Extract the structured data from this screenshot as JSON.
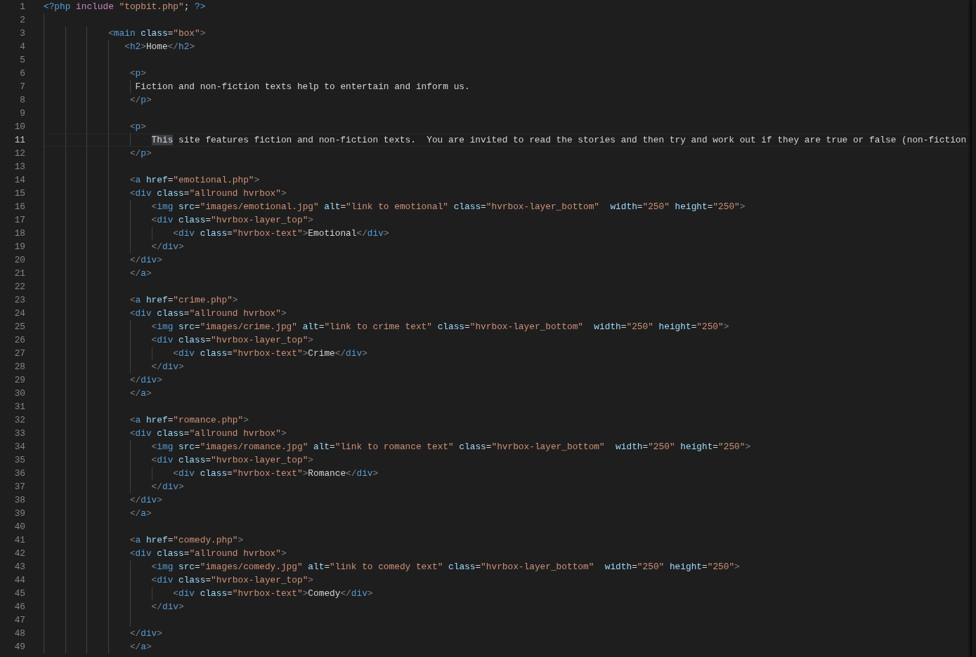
{
  "editor": {
    "lines": [
      {
        "number": "1",
        "current": false,
        "tokens": [
          {
            "kind": "php",
            "text": "<?php"
          },
          {
            "kind": "keyword",
            "text": " include"
          },
          {
            "kind": "string",
            "text": " \"topbit.php\""
          },
          {
            "kind": "text",
            "text": ";"
          },
          {
            "kind": "php",
            "text": " ?>"
          }
        ]
      },
      {
        "number": "2",
        "current": false
      },
      {
        "number": "3",
        "current": false,
        "tokens": [
          {
            "kind": "punct",
            "text": "            <"
          },
          {
            "kind": "tag",
            "text": "main"
          },
          {
            "kind": "attr",
            "text": " class"
          },
          {
            "kind": "text",
            "text": "="
          },
          {
            "kind": "string",
            "text": "\"box\""
          },
          {
            "kind": "punct",
            "text": ">"
          }
        ]
      },
      {
        "number": "4",
        "current": false,
        "tokens": [
          {
            "kind": "punct",
            "text": "               <"
          },
          {
            "kind": "tag",
            "text": "h2"
          },
          {
            "kind": "punct",
            "text": ">"
          },
          {
            "kind": "text",
            "text": "Home"
          },
          {
            "kind": "punct",
            "text": "</"
          },
          {
            "kind": "tag",
            "text": "h2"
          },
          {
            "kind": "punct",
            "text": ">"
          }
        ]
      },
      {
        "number": "5",
        "current": false
      },
      {
        "number": "6",
        "current": false,
        "tokens": [
          {
            "kind": "punct",
            "text": "                <"
          },
          {
            "kind": "tag",
            "text": "p"
          },
          {
            "kind": "punct",
            "text": ">"
          }
        ]
      },
      {
        "number": "7",
        "current": false,
        "tokens": [
          {
            "kind": "text",
            "text": "                 Fiction and non-fiction texts help to entertain and inform us."
          }
        ]
      },
      {
        "number": "8",
        "current": false,
        "tokens": [
          {
            "kind": "punct",
            "text": "                </"
          },
          {
            "kind": "tag",
            "text": "p"
          },
          {
            "kind": "punct",
            "text": ">"
          }
        ]
      },
      {
        "number": "9",
        "current": false
      },
      {
        "number": "10",
        "current": false,
        "tokens": [
          {
            "kind": "punct",
            "text": "                <"
          },
          {
            "kind": "tag",
            "text": "p"
          },
          {
            "kind": "punct",
            "text": ">"
          }
        ]
      },
      {
        "number": "11",
        "current": true,
        "tokens": [
          {
            "kind": "highlight",
            "text": "                    This"
          },
          {
            "kind": "text",
            "text": " site features fiction and non-fiction texts.  You are invited to read the stories and then try and work out if they are true or false (non-fiction"
          }
        ]
      },
      {
        "number": "12",
        "current": false,
        "tokens": [
          {
            "kind": "punct",
            "text": "                </"
          },
          {
            "kind": "tag",
            "text": "p"
          },
          {
            "kind": "punct",
            "text": ">"
          }
        ]
      },
      {
        "number": "13",
        "current": false
      },
      {
        "number": "14",
        "current": false,
        "tokens": [
          {
            "kind": "punct",
            "text": "                <"
          },
          {
            "kind": "tag",
            "text": "a"
          },
          {
            "kind": "attr",
            "text": " href"
          },
          {
            "kind": "text",
            "text": "="
          },
          {
            "kind": "string",
            "text": "\"emotional.php\""
          },
          {
            "kind": "punct",
            "text": ">"
          }
        ]
      },
      {
        "number": "15",
        "current": false,
        "tokens": [
          {
            "kind": "punct",
            "text": "                <"
          },
          {
            "kind": "tag",
            "text": "div"
          },
          {
            "kind": "attr",
            "text": " class"
          },
          {
            "kind": "text",
            "text": "="
          },
          {
            "kind": "string",
            "text": "\"allround hvrbox\""
          },
          {
            "kind": "punct",
            "text": ">"
          }
        ]
      },
      {
        "number": "16",
        "current": false,
        "tokens": [
          {
            "kind": "punct",
            "text": "                    <"
          },
          {
            "kind": "tag",
            "text": "img"
          },
          {
            "kind": "attr",
            "text": " src"
          },
          {
            "kind": "text",
            "text": "="
          },
          {
            "kind": "string",
            "text": "\"images/emotional.jpg\""
          },
          {
            "kind": "attr",
            "text": " alt"
          },
          {
            "kind": "text",
            "text": "="
          },
          {
            "kind": "string",
            "text": "\"link to emotional\""
          },
          {
            "kind": "attr",
            "text": " class"
          },
          {
            "kind": "text",
            "text": "="
          },
          {
            "kind": "string",
            "text": "\"hvrbox-layer_bottom\""
          },
          {
            "kind": "attr",
            "text": "  width"
          },
          {
            "kind": "text",
            "text": "="
          },
          {
            "kind": "string",
            "text": "\"250\""
          },
          {
            "kind": "attr",
            "text": " height"
          },
          {
            "kind": "text",
            "text": "="
          },
          {
            "kind": "string",
            "text": "\"250\""
          },
          {
            "kind": "punct",
            "text": ">"
          }
        ]
      },
      {
        "number": "17",
        "current": false,
        "tokens": [
          {
            "kind": "punct",
            "text": "                    <"
          },
          {
            "kind": "tag",
            "text": "div"
          },
          {
            "kind": "attr",
            "text": " class"
          },
          {
            "kind": "text",
            "text": "="
          },
          {
            "kind": "string",
            "text": "\"hvrbox-layer_top\""
          },
          {
            "kind": "punct",
            "text": ">"
          }
        ]
      },
      {
        "number": "18",
        "current": false,
        "tokens": [
          {
            "kind": "punct",
            "text": "                        <"
          },
          {
            "kind": "tag",
            "text": "div"
          },
          {
            "kind": "attr",
            "text": " class"
          },
          {
            "kind": "text",
            "text": "="
          },
          {
            "kind": "string",
            "text": "\"hvrbox-text\""
          },
          {
            "kind": "punct",
            "text": ">"
          },
          {
            "kind": "text",
            "text": "Emotional"
          },
          {
            "kind": "punct",
            "text": "</"
          },
          {
            "kind": "tag",
            "text": "div"
          },
          {
            "kind": "punct",
            "text": ">"
          }
        ]
      },
      {
        "number": "19",
        "current": false,
        "tokens": [
          {
            "kind": "punct",
            "text": "                    </"
          },
          {
            "kind": "tag",
            "text": "div"
          },
          {
            "kind": "punct",
            "text": ">"
          }
        ]
      },
      {
        "number": "20",
        "current": false,
        "tokens": [
          {
            "kind": "punct",
            "text": "                </"
          },
          {
            "kind": "tag",
            "text": "div"
          },
          {
            "kind": "punct",
            "text": ">"
          }
        ]
      },
      {
        "number": "21",
        "current": false,
        "tokens": [
          {
            "kind": "punct",
            "text": "                </"
          },
          {
            "kind": "tag",
            "text": "a"
          },
          {
            "kind": "punct",
            "text": ">"
          }
        ]
      },
      {
        "number": "22",
        "current": false
      },
      {
        "number": "23",
        "current": false,
        "tokens": [
          {
            "kind": "punct",
            "text": "                <"
          },
          {
            "kind": "tag",
            "text": "a"
          },
          {
            "kind": "attr",
            "text": " href"
          },
          {
            "kind": "text",
            "text": "="
          },
          {
            "kind": "string",
            "text": "\"crime.php\""
          },
          {
            "kind": "punct",
            "text": ">"
          }
        ]
      },
      {
        "number": "24",
        "current": false,
        "tokens": [
          {
            "kind": "punct",
            "text": "                <"
          },
          {
            "kind": "tag",
            "text": "div"
          },
          {
            "kind": "attr",
            "text": " class"
          },
          {
            "kind": "text",
            "text": "="
          },
          {
            "kind": "string",
            "text": "\"allround hvrbox\""
          },
          {
            "kind": "punct",
            "text": ">"
          }
        ]
      },
      {
        "number": "25",
        "current": false,
        "tokens": [
          {
            "kind": "punct",
            "text": "                    <"
          },
          {
            "kind": "tag",
            "text": "img"
          },
          {
            "kind": "attr",
            "text": " src"
          },
          {
            "kind": "text",
            "text": "="
          },
          {
            "kind": "string",
            "text": "\"images/crime.jpg\""
          },
          {
            "kind": "attr",
            "text": " alt"
          },
          {
            "kind": "text",
            "text": "="
          },
          {
            "kind": "string",
            "text": "\"link to crime text\""
          },
          {
            "kind": "attr",
            "text": " class"
          },
          {
            "kind": "text",
            "text": "="
          },
          {
            "kind": "string",
            "text": "\"hvrbox-layer_bottom\""
          },
          {
            "kind": "attr",
            "text": "  width"
          },
          {
            "kind": "text",
            "text": "="
          },
          {
            "kind": "string",
            "text": "\"250\""
          },
          {
            "kind": "attr",
            "text": " height"
          },
          {
            "kind": "text",
            "text": "="
          },
          {
            "kind": "string",
            "text": "\"250\""
          },
          {
            "kind": "punct",
            "text": ">"
          }
        ]
      },
      {
        "number": "26",
        "current": false,
        "tokens": [
          {
            "kind": "punct",
            "text": "                    <"
          },
          {
            "kind": "tag",
            "text": "div"
          },
          {
            "kind": "attr",
            "text": " class"
          },
          {
            "kind": "text",
            "text": "="
          },
          {
            "kind": "string",
            "text": "\"hvrbox-layer_top\""
          },
          {
            "kind": "punct",
            "text": ">"
          }
        ]
      },
      {
        "number": "27",
        "current": false,
        "tokens": [
          {
            "kind": "punct",
            "text": "                        <"
          },
          {
            "kind": "tag",
            "text": "div"
          },
          {
            "kind": "attr",
            "text": " class"
          },
          {
            "kind": "text",
            "text": "="
          },
          {
            "kind": "string",
            "text": "\"hvrbox-text\""
          },
          {
            "kind": "punct",
            "text": ">"
          },
          {
            "kind": "text",
            "text": "Crime"
          },
          {
            "kind": "punct",
            "text": "</"
          },
          {
            "kind": "tag",
            "text": "div"
          },
          {
            "kind": "punct",
            "text": ">"
          }
        ]
      },
      {
        "number": "28",
        "current": false,
        "tokens": [
          {
            "kind": "punct",
            "text": "                    </"
          },
          {
            "kind": "tag",
            "text": "div"
          },
          {
            "kind": "punct",
            "text": ">"
          }
        ]
      },
      {
        "number": "29",
        "current": false,
        "tokens": [
          {
            "kind": "punct",
            "text": "                </"
          },
          {
            "kind": "tag",
            "text": "div"
          },
          {
            "kind": "punct",
            "text": ">"
          }
        ]
      },
      {
        "number": "30",
        "current": false,
        "tokens": [
          {
            "kind": "punct",
            "text": "                </"
          },
          {
            "kind": "tag",
            "text": "a"
          },
          {
            "kind": "punct",
            "text": ">"
          }
        ]
      },
      {
        "number": "31",
        "current": false
      },
      {
        "number": "32",
        "current": false,
        "tokens": [
          {
            "kind": "punct",
            "text": "                <"
          },
          {
            "kind": "tag",
            "text": "a"
          },
          {
            "kind": "attr",
            "text": " href"
          },
          {
            "kind": "text",
            "text": "="
          },
          {
            "kind": "string",
            "text": "\"romance.php\""
          },
          {
            "kind": "punct",
            "text": ">"
          }
        ]
      },
      {
        "number": "33",
        "current": false,
        "tokens": [
          {
            "kind": "punct",
            "text": "                <"
          },
          {
            "kind": "tag",
            "text": "div"
          },
          {
            "kind": "attr",
            "text": " class"
          },
          {
            "kind": "text",
            "text": "="
          },
          {
            "kind": "string",
            "text": "\"allround hvrbox\""
          },
          {
            "kind": "punct",
            "text": ">"
          }
        ]
      },
      {
        "number": "34",
        "current": false,
        "tokens": [
          {
            "kind": "punct",
            "text": "                    <"
          },
          {
            "kind": "tag",
            "text": "img"
          },
          {
            "kind": "attr",
            "text": " src"
          },
          {
            "kind": "text",
            "text": "="
          },
          {
            "kind": "string",
            "text": "\"images/romance.jpg\""
          },
          {
            "kind": "attr",
            "text": " alt"
          },
          {
            "kind": "text",
            "text": "="
          },
          {
            "kind": "string",
            "text": "\"link to romance text\""
          },
          {
            "kind": "attr",
            "text": " class"
          },
          {
            "kind": "text",
            "text": "="
          },
          {
            "kind": "string",
            "text": "\"hvrbox-layer_bottom\""
          },
          {
            "kind": "attr",
            "text": "  width"
          },
          {
            "kind": "text",
            "text": "="
          },
          {
            "kind": "string",
            "text": "\"250\""
          },
          {
            "kind": "attr",
            "text": " height"
          },
          {
            "kind": "text",
            "text": "="
          },
          {
            "kind": "string",
            "text": "\"250\""
          },
          {
            "kind": "punct",
            "text": ">"
          }
        ]
      },
      {
        "number": "35",
        "current": false,
        "tokens": [
          {
            "kind": "punct",
            "text": "                    <"
          },
          {
            "kind": "tag",
            "text": "div"
          },
          {
            "kind": "attr",
            "text": " class"
          },
          {
            "kind": "text",
            "text": "="
          },
          {
            "kind": "string",
            "text": "\"hvrbox-layer_top\""
          },
          {
            "kind": "punct",
            "text": ">"
          }
        ]
      },
      {
        "number": "36",
        "current": false,
        "tokens": [
          {
            "kind": "punct",
            "text": "                        <"
          },
          {
            "kind": "tag",
            "text": "div"
          },
          {
            "kind": "attr",
            "text": " class"
          },
          {
            "kind": "text",
            "text": "="
          },
          {
            "kind": "string",
            "text": "\"hvrbox-text\""
          },
          {
            "kind": "punct",
            "text": ">"
          },
          {
            "kind": "text",
            "text": "Romance"
          },
          {
            "kind": "punct",
            "text": "</"
          },
          {
            "kind": "tag",
            "text": "div"
          },
          {
            "kind": "punct",
            "text": ">"
          }
        ]
      },
      {
        "number": "37",
        "current": false,
        "tokens": [
          {
            "kind": "punct",
            "text": "                    </"
          },
          {
            "kind": "tag",
            "text": "div"
          },
          {
            "kind": "punct",
            "text": ">"
          }
        ]
      },
      {
        "number": "38",
        "current": false,
        "tokens": [
          {
            "kind": "punct",
            "text": "                </"
          },
          {
            "kind": "tag",
            "text": "div"
          },
          {
            "kind": "punct",
            "text": ">"
          }
        ]
      },
      {
        "number": "39",
        "current": false,
        "tokens": [
          {
            "kind": "punct",
            "text": "                </"
          },
          {
            "kind": "tag",
            "text": "a"
          },
          {
            "kind": "punct",
            "text": ">"
          }
        ]
      },
      {
        "number": "40",
        "current": false
      },
      {
        "number": "41",
        "current": false,
        "tokens": [
          {
            "kind": "punct",
            "text": "                <"
          },
          {
            "kind": "tag",
            "text": "a"
          },
          {
            "kind": "attr",
            "text": " href"
          },
          {
            "kind": "text",
            "text": "="
          },
          {
            "kind": "string",
            "text": "\"comedy.php\""
          },
          {
            "kind": "punct",
            "text": ">"
          }
        ]
      },
      {
        "number": "42",
        "current": false,
        "tokens": [
          {
            "kind": "punct",
            "text": "                <"
          },
          {
            "kind": "tag",
            "text": "div"
          },
          {
            "kind": "attr",
            "text": " class"
          },
          {
            "kind": "text",
            "text": "="
          },
          {
            "kind": "string",
            "text": "\"allround hvrbox\""
          },
          {
            "kind": "punct",
            "text": ">"
          }
        ]
      },
      {
        "number": "43",
        "current": false,
        "tokens": [
          {
            "kind": "punct",
            "text": "                    <"
          },
          {
            "kind": "tag",
            "text": "img"
          },
          {
            "kind": "attr",
            "text": " src"
          },
          {
            "kind": "text",
            "text": "="
          },
          {
            "kind": "string",
            "text": "\"images/comedy.jpg\""
          },
          {
            "kind": "attr",
            "text": " alt"
          },
          {
            "kind": "text",
            "text": "="
          },
          {
            "kind": "string",
            "text": "\"link to comedy text\""
          },
          {
            "kind": "attr",
            "text": " class"
          },
          {
            "kind": "text",
            "text": "="
          },
          {
            "kind": "string",
            "text": "\"hvrbox-layer_bottom\""
          },
          {
            "kind": "attr",
            "text": "  width"
          },
          {
            "kind": "text",
            "text": "="
          },
          {
            "kind": "string",
            "text": "\"250\""
          },
          {
            "kind": "attr",
            "text": " height"
          },
          {
            "kind": "text",
            "text": "="
          },
          {
            "kind": "string",
            "text": "\"250\""
          },
          {
            "kind": "punct",
            "text": ">"
          }
        ]
      },
      {
        "number": "44",
        "current": false,
        "tokens": [
          {
            "kind": "punct",
            "text": "                    <"
          },
          {
            "kind": "tag",
            "text": "div"
          },
          {
            "kind": "attr",
            "text": " class"
          },
          {
            "kind": "text",
            "text": "="
          },
          {
            "kind": "string",
            "text": "\"hvrbox-layer_top\""
          },
          {
            "kind": "punct",
            "text": ">"
          }
        ]
      },
      {
        "number": "45",
        "current": false,
        "tokens": [
          {
            "kind": "punct",
            "text": "                        <"
          },
          {
            "kind": "tag",
            "text": "div"
          },
          {
            "kind": "attr",
            "text": " class"
          },
          {
            "kind": "text",
            "text": "="
          },
          {
            "kind": "string",
            "text": "\"hvrbox-text\""
          },
          {
            "kind": "punct",
            "text": ">"
          },
          {
            "kind": "text",
            "text": "Comedy"
          },
          {
            "kind": "punct",
            "text": "</"
          },
          {
            "kind": "tag",
            "text": "div"
          },
          {
            "kind": "punct",
            "text": ">"
          }
        ]
      },
      {
        "number": "46",
        "current": false,
        "tokens": [
          {
            "kind": "punct",
            "text": "                    </"
          },
          {
            "kind": "tag",
            "text": "div"
          },
          {
            "kind": "punct",
            "text": ">"
          }
        ]
      },
      {
        "number": "47",
        "current": false
      },
      {
        "number": "48",
        "current": false,
        "tokens": [
          {
            "kind": "punct",
            "text": "                </"
          },
          {
            "kind": "tag",
            "text": "div"
          },
          {
            "kind": "punct",
            "text": ">"
          }
        ]
      },
      {
        "number": "49",
        "current": false,
        "tokens": [
          {
            "kind": "punct",
            "text": "                </"
          },
          {
            "kind": "tag",
            "text": "a"
          },
          {
            "kind": "punct",
            "text": ">"
          }
        ]
      }
    ]
  }
}
